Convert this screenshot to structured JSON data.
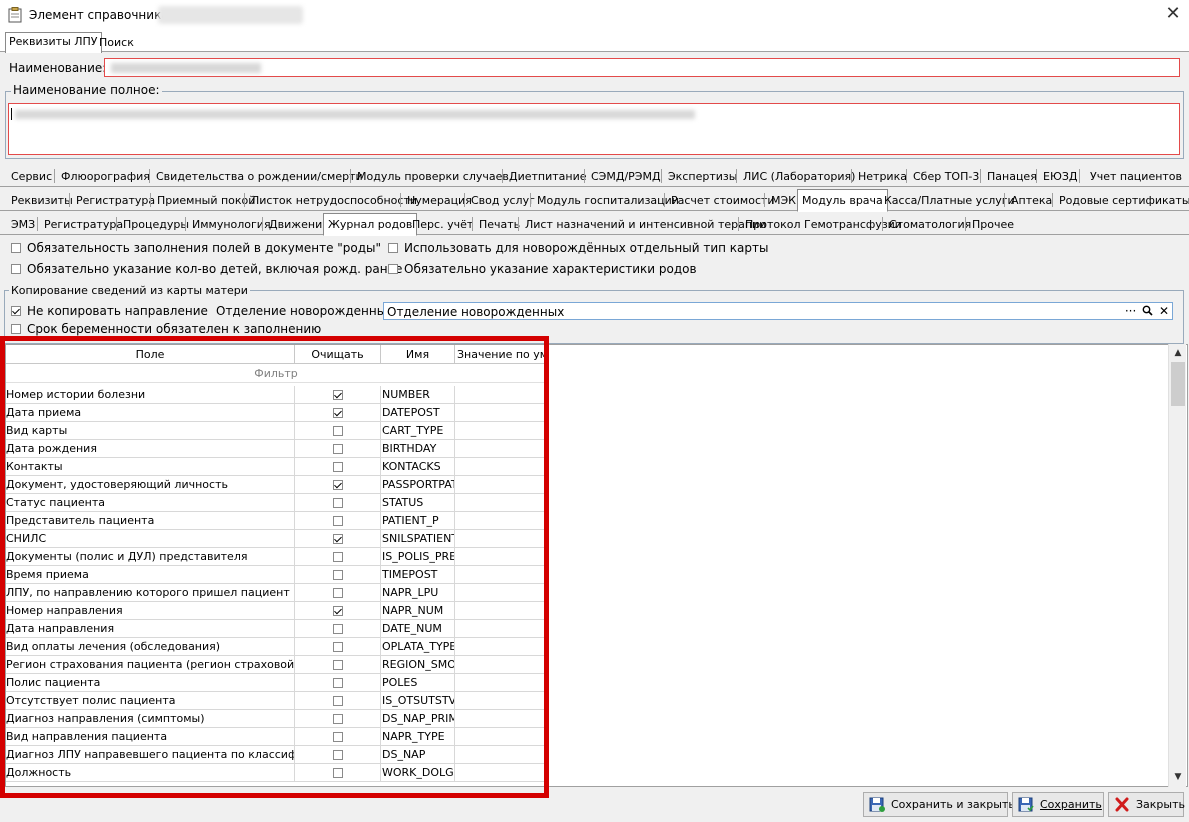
{
  "window": {
    "title": "Элемент справочника:",
    "close_glyph": "✕"
  },
  "top_tabs": [
    {
      "label": "Реквизиты ЛПУ",
      "active": true
    },
    {
      "label": "Поиск",
      "active": false
    }
  ],
  "fields": {
    "name_label": "Наименование:",
    "full_name_label": "Наименование полное:"
  },
  "tab_row1": [
    "Сервис",
    "Флюорография",
    "Свидетельства о рождении/смерти",
    "Модуль проверки случаев",
    "Диетпитание",
    "СЭМД/РЭМД",
    "Экспертизы",
    "ЛИС (Лаборатория)",
    "Нетрика",
    "Сбер ТОП-3",
    "Панацея",
    "ЕЮЗД",
    "Учет пациентов"
  ],
  "tab_row2": [
    "Реквизиты",
    "Регистратура",
    "Приемный покой",
    "Листок нетрудоспособности",
    "Нумерация",
    "Свод услуг",
    "Модуль госпитализации",
    "Расчет стоимости",
    "МЭК",
    "Модуль врача",
    "Касса/Платные услуги",
    "Аптека",
    "Родовые сертификаты"
  ],
  "tab_row2_active": "Модуль врача",
  "tab_row3": [
    "ЭМЗ",
    "Регистратура",
    "Процедуры",
    "Иммунология",
    "Движения",
    "Журнал родов",
    "Перс. учёт",
    "Печать",
    "Лист назначений и интенсивной терапии",
    "Протокол Гемотрансфузии",
    "Стоматология",
    "Прочее"
  ],
  "tab_row3_active": "Журнал родов",
  "options": {
    "opt1": {
      "label": "Обязательность заполнения полей в документе \"роды\"",
      "checked": false
    },
    "opt2": {
      "label": "Использовать для новорождённых отдельный тип карты",
      "checked": false
    },
    "opt3": {
      "label": "Обязательно указание кол-во детей, включая рожд. ранее",
      "checked": false
    },
    "opt4": {
      "label": "Обязательно указание характеристики родов",
      "checked": false
    }
  },
  "copy_group": {
    "title": "Копирование сведений из карты матери",
    "no_copy": {
      "label": "Не копировать направление",
      "checked": true
    },
    "dept_label": "Отделение новорожденных:",
    "dept_value": "Отделение новорожденных",
    "dept_buttons": "··· 🔍 ✕",
    "pregnancy": {
      "label": "Срок беременности обязателен к заполнению",
      "checked": false
    }
  },
  "grid": {
    "headers": [
      "Поле",
      "Очищать",
      "Имя",
      "Значение по умолчанию"
    ],
    "filter_label": "Фильтр",
    "rows": [
      {
        "field": "Номер истории болезни",
        "clear": true,
        "name": "NUMBER"
      },
      {
        "field": "Дата приема",
        "clear": true,
        "name": "DATEPOST"
      },
      {
        "field": "Вид карты",
        "clear": false,
        "name": "CART_TYPE"
      },
      {
        "field": "Дата рождения",
        "clear": false,
        "name": "BIRTHDAY"
      },
      {
        "field": "Контакты",
        "clear": false,
        "name": "KONTACKS"
      },
      {
        "field": "Документ, удостоверяющий личность",
        "clear": true,
        "name": "PASSPORTPAT"
      },
      {
        "field": "Статус пациента",
        "clear": false,
        "name": "STATUS"
      },
      {
        "field": "Представитель пациента",
        "clear": false,
        "name": "PATIENT_P"
      },
      {
        "field": "СНИЛС",
        "clear": true,
        "name": "SNILSPATIENT"
      },
      {
        "field": "Документы (полис и ДУЛ) представителя",
        "clear": false,
        "name": "IS_POLIS_PRE"
      },
      {
        "field": "Время приема",
        "clear": false,
        "name": "TIMEPOST"
      },
      {
        "field": "ЛПУ, по направлению которого пришел пациент",
        "clear": false,
        "name": "NAPR_LPU"
      },
      {
        "field": "Номер направления",
        "clear": true,
        "name": "NAPR_NUM"
      },
      {
        "field": "Дата направления",
        "clear": false,
        "name": "DATE_NUM"
      },
      {
        "field": "Вид оплаты лечения (обследования)",
        "clear": false,
        "name": "OPLATA_TYPE"
      },
      {
        "field": "Регион страхования пациента (регион страховой компании)",
        "clear": false,
        "name": "REGION_SMO"
      },
      {
        "field": "Полис пациента",
        "clear": false,
        "name": "POLES"
      },
      {
        "field": "Отсутствует полис пациента",
        "clear": false,
        "name": "IS_OTSUTSTVU"
      },
      {
        "field": "Диагноз направления (симптомы)",
        "clear": false,
        "name": "DS_NAP_PRIM"
      },
      {
        "field": "Вид направления пациента",
        "clear": false,
        "name": "NAPR_TYPE"
      },
      {
        "field": "Диагноз ЛПУ направевшего пациента по классификатору",
        "clear": false,
        "name": "DS_NAP"
      },
      {
        "field": "Должность",
        "clear": false,
        "name": "WORK_DOLGN"
      }
    ]
  },
  "buttons": {
    "save_close": "Сохранить и закрыть",
    "save": "Сохранить",
    "close": "Закрыть"
  },
  "colors": {
    "highlight": "#d40000",
    "required_border": "#e34a4a"
  }
}
